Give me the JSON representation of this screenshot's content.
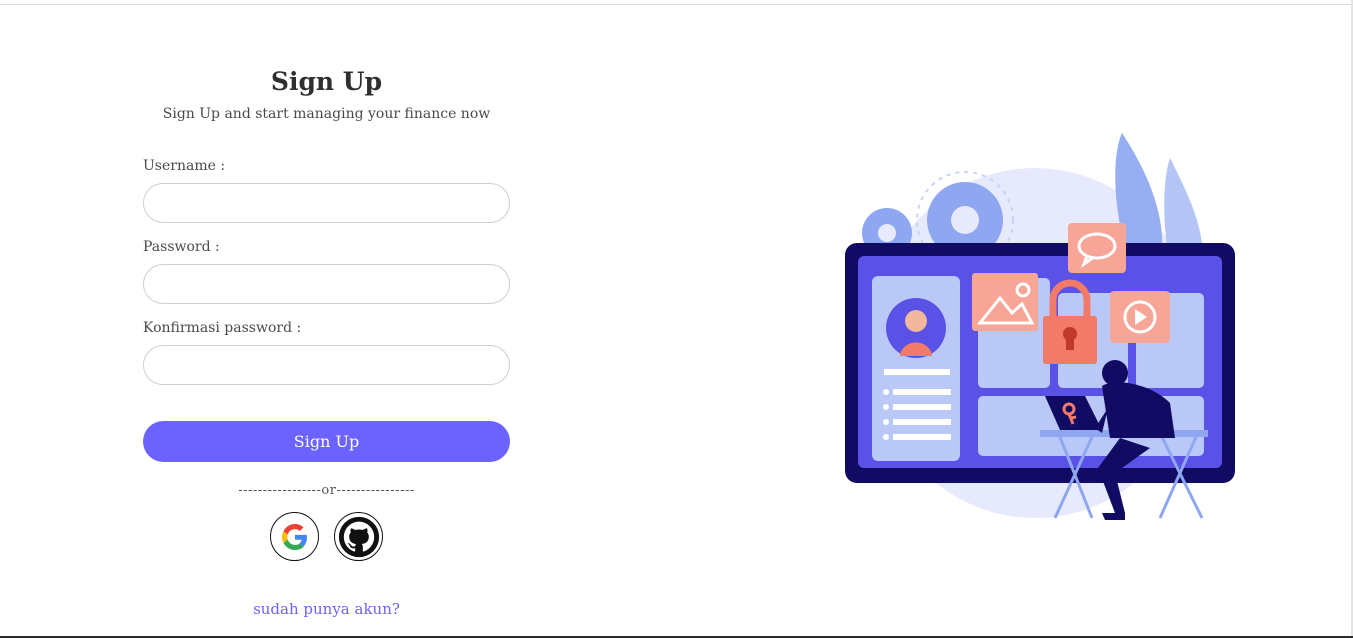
{
  "signup": {
    "title": "Sign Up",
    "subtitle": "Sign Up and start managing your finance now",
    "username_label": "Username :",
    "username_value": "",
    "password_label": "Password :",
    "password_value": "",
    "confirm_label": "Konfirmasi password :",
    "confirm_value": "",
    "submit_label": "Sign Up",
    "divider_text": "-----------------or----------------",
    "login_link": "sudah punya akun?"
  },
  "social": {
    "google_icon": "google-icon",
    "github_icon": "github-icon"
  },
  "colors": {
    "accent": "#6c63ff",
    "text": "#2f2f2f",
    "illustration_screen": "#5a52e6",
    "illustration_coral": "#f27a68"
  }
}
